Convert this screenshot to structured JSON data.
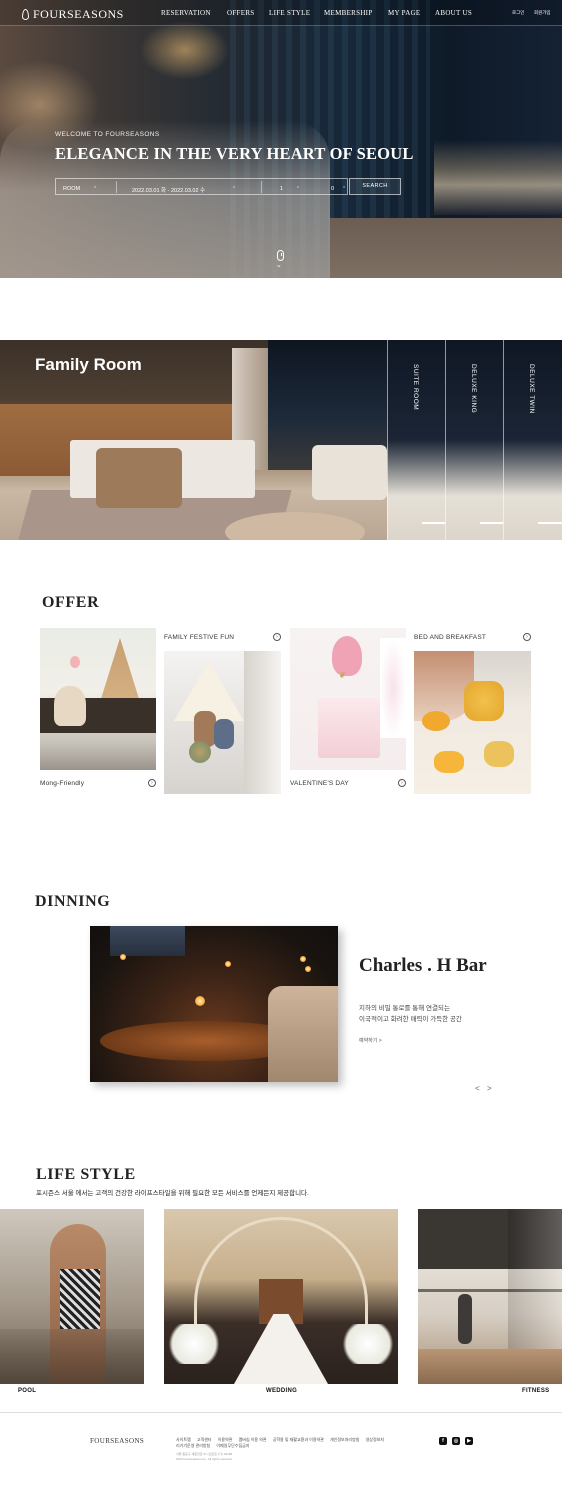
{
  "header": {
    "logo": "FOURSEASONS",
    "nav": [
      "RESERVATION",
      "OFFERS",
      "LIFE STYLE",
      "MEMBERSHIP",
      "MY PAGE",
      "ABOUT US"
    ],
    "utility": [
      "로그인",
      "회원가입"
    ]
  },
  "hero": {
    "welcome": "WELCOME TO FOURSEASONS",
    "headline": "ELEGANCE IN THE VERY HEART OF SEOUL",
    "search": {
      "room_value": "ROOM",
      "date_value": "2022.03.01 화  -  2022.03.02 수",
      "adults": "1",
      "children": "0",
      "button": "SEARCH"
    }
  },
  "rooms": {
    "active": "Family Room",
    "tabs": [
      "SUITE ROOM",
      "DELUXE KING",
      "DELUXE TWIN"
    ]
  },
  "offer": {
    "title": "OFFER",
    "cards": [
      {
        "caption": "Mong-Friendly",
        "position": "bottom"
      },
      {
        "caption": "FAMILY FESTIVE FUN",
        "position": "top"
      },
      {
        "caption": "VALENTINE'S DAY",
        "position": "bottom"
      },
      {
        "caption": "BED AND BREAKFAST",
        "position": "top"
      }
    ]
  },
  "dining": {
    "title": "DINNING",
    "name": "Charles . H Bar",
    "desc_line1": "지하의 비밀 통로를 통해 연결되는",
    "desc_line2": "이국적이고 화려한 매력이 가득한 공간",
    "more": "예약하기  >",
    "prev": "<",
    "next": ">"
  },
  "lifestyle": {
    "title": "LIFE STYLE",
    "subtitle": "포시즌스 서울 에서는 고객의 건강한 라이프스타일을 위해 필요한 모든 서비스를 언제든지 제공합니다.",
    "items": [
      "POOL",
      "WEDDING",
      "FITNESS"
    ]
  },
  "footer": {
    "logo": "FOURSEASONS",
    "links": [
      "사이트맵",
      "고객센터",
      "이용약관",
      "멤버십 이용 약관",
      "공학용 및 재활교환과 이용약관",
      "개인정보처리방침",
      "영상정보처리기기운영 관리방침",
      "이메일무단수집금지"
    ],
    "copy_line1": "서울 종로구 새문안로 97 (신문로 1가) 03183",
    "copy_line2": "2022 Fourseasons H.L. All rights reserved.",
    "sns": [
      "facebook-icon",
      "instagram-icon",
      "youtube-icon"
    ]
  }
}
